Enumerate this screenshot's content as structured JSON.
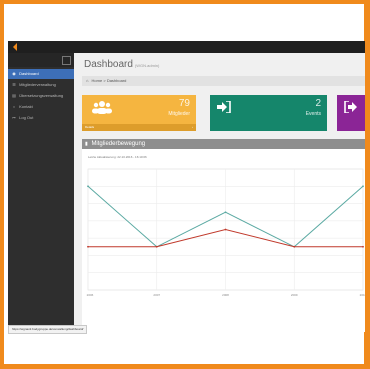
{
  "sidebar": {
    "items": [
      {
        "label": "Dashboard",
        "icon": "dashboard-icon",
        "glyph": "◉",
        "active": true
      },
      {
        "label": "Mitgliederverwaltung",
        "icon": "users-icon",
        "glyph": "☰",
        "active": false
      },
      {
        "label": "Übersetzungsverwaltung",
        "icon": "translate-icon",
        "glyph": "▤",
        "active": false
      },
      {
        "label": "Kontakt",
        "icon": "contact-icon",
        "glyph": "○",
        "active": false
      },
      {
        "label": "Log Out",
        "icon": "logout-icon",
        "glyph": "↦",
        "active": false
      }
    ]
  },
  "header": {
    "title": "Dashboard",
    "subtitle": "(WGN.admin)"
  },
  "breadcrumb": {
    "home": "Home",
    "separator": ">",
    "current": "Dashboard"
  },
  "cards": [
    {
      "number": "79",
      "label": "Mitglieder",
      "footer": "Details",
      "icon": "users-icon",
      "color": "#f5b540"
    },
    {
      "number": "2",
      "label": "Events",
      "icon": "sign-in-icon",
      "color": "#15866b"
    },
    {
      "icon": "sign-out-icon",
      "color": "#8b2596"
    }
  ],
  "panel": {
    "title": "Mitgliederbewegung",
    "subtitle": "Letzte Aktualisierung: 22.10.2016 - 16:10:06"
  },
  "status_url": "https://wgnav2.bodygruppe.de/verwaltung/dashboard/",
  "chart_data": {
    "type": "line",
    "x": [
      "2006",
      "2007",
      "2008",
      "2009",
      "2010"
    ],
    "series": [
      {
        "color": "#5aa9a2",
        "values": [
          12,
          5,
          9,
          5,
          12
        ]
      },
      {
        "color": "#c0392b",
        "values": [
          5,
          5,
          7,
          5,
          5
        ]
      }
    ],
    "ylim": [
      0,
      14
    ],
    "grid": true,
    "legend": "none"
  }
}
